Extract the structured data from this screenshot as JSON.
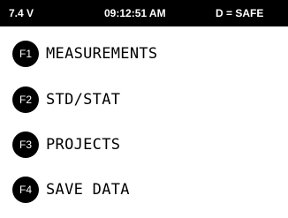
{
  "status": {
    "battery": "7.4 V",
    "time": "09:12:51 AM",
    "mode": "D = SAFE"
  },
  "menu": {
    "items": [
      {
        "key": "F1",
        "label": "MEASUREMENTS"
      },
      {
        "key": "F2",
        "label": "STD/STAT"
      },
      {
        "key": "F3",
        "label": "PROJECTS"
      },
      {
        "key": "F4",
        "label": "SAVE DATA"
      }
    ]
  },
  "colors": {
    "bar_background": "#000000",
    "bar_text": "#ffffff",
    "screen_background": "#ffffff",
    "text": "#000000"
  }
}
